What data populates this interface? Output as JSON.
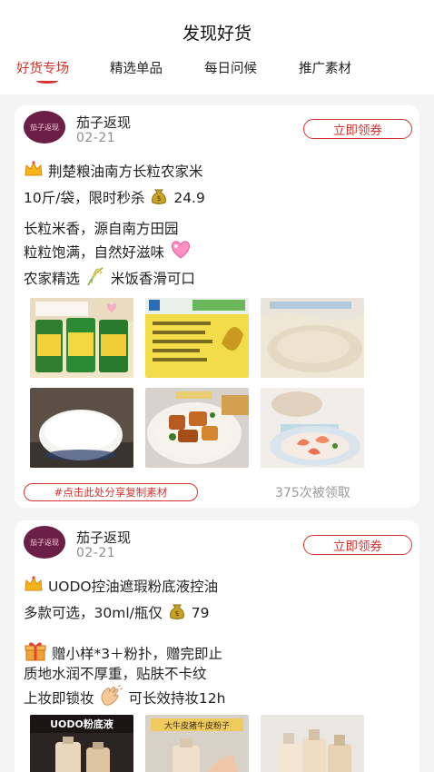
{
  "header": {
    "title": "发现好货",
    "tabs": [
      "好货专场",
      "精选单品",
      "每日问候",
      "推广素材"
    ],
    "active_tab": "好货专场"
  },
  "accent_color": "#d6322e",
  "posts": [
    {
      "shop_name": "茄子返现",
      "avatar_label": "茄子返现",
      "date": "02-21",
      "coupon_label": "立即领券",
      "lines": [
        {
          "icon": "crown-icon",
          "text": "荆楚粮油南方长粒农家米"
        },
        {
          "text": "10斤/袋，限时秒杀",
          "icon_after": "money-bag-icon",
          "after": "24.9"
        },
        {
          "text": "长粒米香，源自南方田园"
        },
        {
          "text": "粒粒饱满，自然好滋味",
          "icon_after": "heart-icon"
        },
        {
          "text": "农家精选",
          "icon_after": "rice-plant-icon",
          "after": "米饭香滑可口"
        }
      ],
      "images": [
        "rice-bags-photo",
        "rice-bag-label-photo",
        "raw-rice-photo",
        "cooked-rice-bowl-photo",
        "braised-dish-photo",
        "shrimp-dish-photo"
      ],
      "share_label": "#点击此处分享复制素材",
      "claimed_text": "375次被领取"
    },
    {
      "shop_name": "茄子返现",
      "avatar_label": "茄子返现",
      "date": "02-21",
      "coupon_label": "立即领券",
      "lines": [
        {
          "icon": "crown-icon",
          "text": "UODO控油遮瑕粉底液控油"
        },
        {
          "text": "多款可选，30ml/瓶仅",
          "icon_after": "money-bag-icon",
          "after": "79"
        },
        {
          "icon": "gift-icon",
          "text": "赠小样*3＋粉扑，赠完即止"
        },
        {
          "text": "质地水润不厚重，贴肤不卡纹"
        },
        {
          "text": "上妆即锁妆",
          "icon_after": "clap-icon",
          "after": "可长效持妆12h"
        }
      ],
      "images": [
        "foundation-bottle-photo",
        "foundation-hand-photo",
        "foundation-bottles-photo"
      ],
      "image_captions": [
        "UODO粉底液",
        "大牛皮猪牛皮粉子"
      ]
    }
  ]
}
